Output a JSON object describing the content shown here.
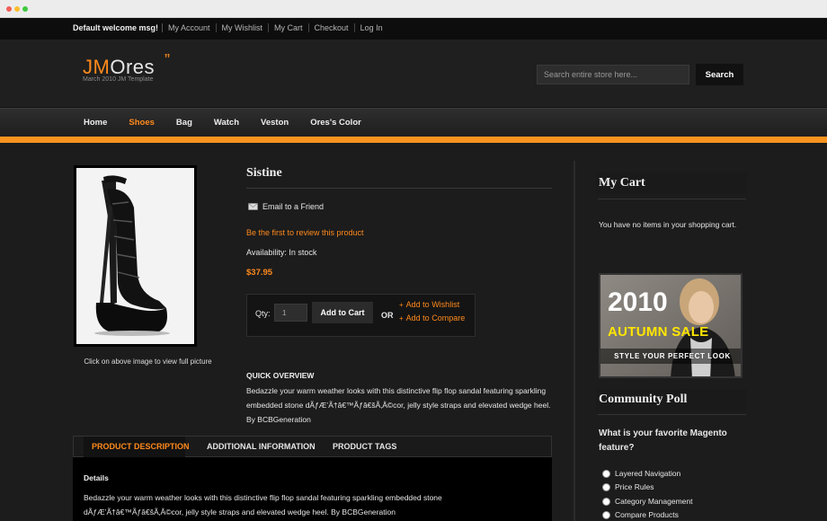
{
  "topbar": {
    "welcome": "Default welcome msg!",
    "links": [
      "My Account",
      "My Wishlist",
      "My Cart",
      "Checkout",
      "Log In"
    ]
  },
  "header": {
    "logo_main": "JM",
    "logo_rest": "Ores",
    "logo_quote": "”",
    "tagline": "March 2010 JM Template",
    "search_placeholder": "Search entire store here...",
    "search_label": "Search"
  },
  "nav": {
    "items": [
      "Home",
      "Shoes",
      "Bag",
      "Watch",
      "Veston",
      "Ores's Color"
    ],
    "active": "Shoes"
  },
  "product": {
    "image_caption": "Click on above image to view full picture",
    "title": "Sistine",
    "email_label": "Email to a Friend",
    "review_label": "Be the first to review this product",
    "availability": "Availability: In stock",
    "price": "$37.95",
    "qty_label": "Qty:",
    "qty_value": "1",
    "add_to_cart": "Add to Cart",
    "or_label": "OR",
    "wishlist_label": "Add to Wishlist",
    "compare_label": "Add to Compare",
    "quick_overview_title": "QUICK OVERVIEW",
    "quick_overview_text": "Bedazzle your warm weather looks with this distinctive flip flop sandal featuring sparkling embedded stone dÃƒÆ’Ã†â€™Ãƒâ€šÃ‚Â©cor, jelly style straps and elevated wedge heel. By BCBGeneration"
  },
  "tabs": {
    "items": [
      "PRODUCT DESCRIPTION",
      "ADDITIONAL INFORMATION",
      "PRODUCT TAGS"
    ],
    "active": "PRODUCT DESCRIPTION",
    "details_heading": "Details",
    "details_text": "Bedazzle your warm weather looks with this distinctive flip flop sandal featuring sparkling embedded stone dÃƒÆ’Ã†â€™Ãƒâ€šÃ‚Â©cor, jelly style straps and elevated wedge heel. By BCBGeneration"
  },
  "sidebar": {
    "cart_title": "My Cart",
    "cart_empty": "You have no items in your shopping cart.",
    "promo": {
      "year": "2010",
      "sale": "AUTUMN SALE",
      "tagline": "STYLE YOUR PERFECT LOOK"
    },
    "poll_title": "Community Poll",
    "poll_question": "What is your favorite Magento feature?",
    "poll_options": [
      "Layered Navigation",
      "Price Rules",
      "Category Management",
      "Compare Products"
    ]
  },
  "colors": {
    "accent": "#f7931e",
    "link": "#ff8a1c",
    "background": "#1c1c1c"
  }
}
